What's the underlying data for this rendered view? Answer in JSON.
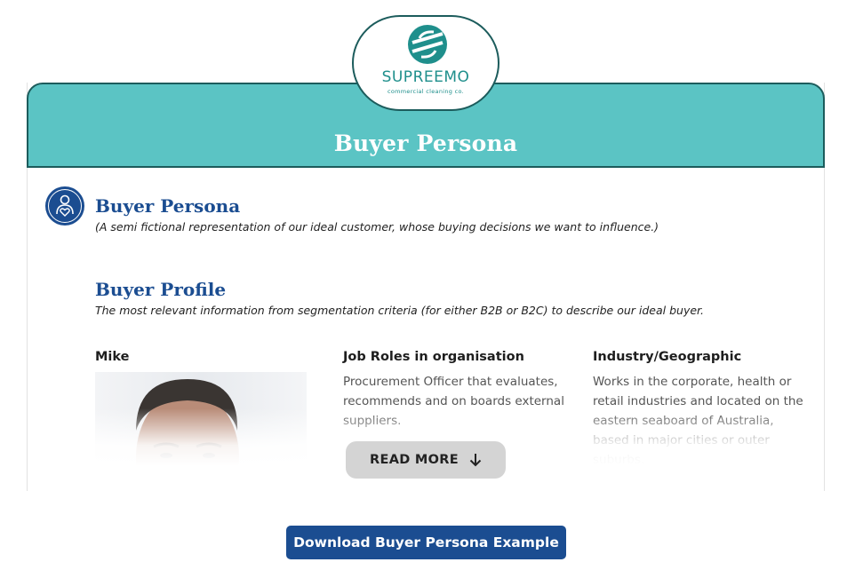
{
  "brand": {
    "name": "SUPREEMO",
    "tagline": "commercial cleaning co."
  },
  "banner": {
    "title": "Buyer Persona"
  },
  "persona_section": {
    "title": "Buyer Persona",
    "subtitle": "(A semi fictional representation of our ideal customer, whose buying decisions we want to influence.)"
  },
  "profile_section": {
    "title": "Buyer Profile",
    "subtitle": "The most relevant information from segmentation criteria (for either B2B or B2C) to describe our ideal buyer."
  },
  "columns": {
    "persona_name": "Mike",
    "job_roles": {
      "title": "Job Roles in organisation",
      "text": "Procurement Officer that evaluates, recommends and on boards external suppliers."
    },
    "industry": {
      "title": "Industry/Geographic",
      "text": "Works in the corporate, health or retail industries and located on the eastern seaboard of Australia, based in major cities or outer suburbs."
    }
  },
  "buttons": {
    "read_more": "READ MORE",
    "download": "Download Buyer Persona Example"
  },
  "colors": {
    "teal": "#5bc4c4",
    "dark_teal": "#1c5c5c",
    "brand_blue": "#1b4d91",
    "logo_teal": "#1f8f8c"
  },
  "icons": {
    "persona": "person-heart-icon",
    "logo": "supreemo-logo-mark",
    "read_more": "arrow-down-icon"
  }
}
